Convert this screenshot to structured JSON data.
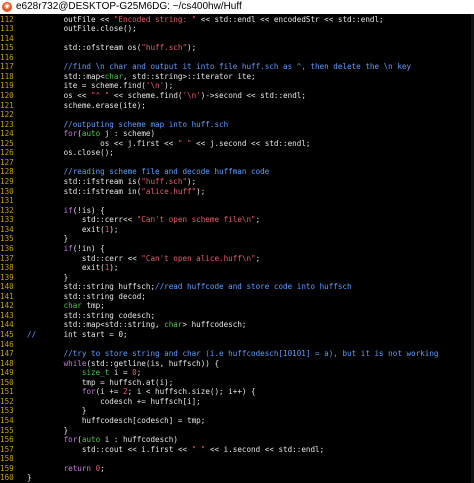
{
  "window": {
    "title": "e628r732@DESKTOP-G25M6DG: ~/cs400hw/Huff",
    "icon": "ubuntu-icon"
  },
  "colors": {
    "background": "#000000",
    "line_number": "#c4a000",
    "text": "#e5e5e5",
    "comment": "#5c9cff",
    "string": "#e35d6a",
    "number": "#e35d6a",
    "keyword": "#c678dd",
    "type": "#4ec94e"
  },
  "lines": [
    {
      "n": "112",
      "segs": [
        [
          "t",
          "        outFile << "
        ],
        [
          "s",
          "\"Encoded string: \""
        ],
        [
          "t",
          " << std::endl << encodedStr << std::endl;"
        ]
      ]
    },
    {
      "n": "113",
      "segs": [
        [
          "t",
          "        outFile.close();"
        ]
      ]
    },
    {
      "n": "114",
      "segs": []
    },
    {
      "n": "115",
      "segs": [
        [
          "t",
          "        std::ofstream os("
        ],
        [
          "s",
          "\"huff.sch\""
        ],
        [
          "t",
          ");"
        ]
      ]
    },
    {
      "n": "116",
      "segs": []
    },
    {
      "n": "117",
      "segs": [
        [
          "c",
          "        //find \\n char and output it into file huff.sch as ^, then delete the \\n key"
        ]
      ]
    },
    {
      "n": "118",
      "segs": [
        [
          "t",
          "        std::map<"
        ],
        [
          "y",
          "char"
        ],
        [
          "t",
          ", std::string>::iterator ite;"
        ]
      ]
    },
    {
      "n": "119",
      "segs": [
        [
          "t",
          "        ite = scheme.find("
        ],
        [
          "s",
          "'\\n'"
        ],
        [
          "t",
          ");"
        ]
      ]
    },
    {
      "n": "120",
      "segs": [
        [
          "t",
          "        os << "
        ],
        [
          "s",
          "\"^ \""
        ],
        [
          "t",
          " << scheme.find("
        ],
        [
          "s",
          "'\\n'"
        ],
        [
          "t",
          ")->second << std::endl;"
        ]
      ]
    },
    {
      "n": "121",
      "segs": [
        [
          "t",
          "        scheme.erase(ite);"
        ]
      ]
    },
    {
      "n": "122",
      "segs": []
    },
    {
      "n": "123",
      "segs": [
        [
          "c",
          "        //outputing scheme map into huff.sch"
        ]
      ]
    },
    {
      "n": "124",
      "segs": [
        [
          "t",
          "        "
        ],
        [
          "k",
          "for"
        ],
        [
          "t",
          "("
        ],
        [
          "y",
          "auto"
        ],
        [
          "t",
          " j : scheme)"
        ]
      ]
    },
    {
      "n": "125",
      "segs": [
        [
          "t",
          "                os << j.first << "
        ],
        [
          "s",
          "\" \""
        ],
        [
          "t",
          " << j.second << std::endl;"
        ]
      ]
    },
    {
      "n": "126",
      "segs": [
        [
          "t",
          "        os.close();"
        ]
      ]
    },
    {
      "n": "127",
      "segs": []
    },
    {
      "n": "128",
      "segs": [
        [
          "c",
          "        //reading scheme file and decode huffman code"
        ]
      ]
    },
    {
      "n": "129",
      "segs": [
        [
          "t",
          "        std::ifstream is("
        ],
        [
          "s",
          "\"huff.sch\""
        ],
        [
          "t",
          ");"
        ]
      ]
    },
    {
      "n": "130",
      "segs": [
        [
          "t",
          "        std::ifstream in("
        ],
        [
          "s",
          "\"alice.huff\""
        ],
        [
          "t",
          ");"
        ]
      ]
    },
    {
      "n": "131",
      "segs": []
    },
    {
      "n": "132",
      "segs": [
        [
          "t",
          "        "
        ],
        [
          "k",
          "if"
        ],
        [
          "t",
          "(!is) {"
        ]
      ]
    },
    {
      "n": "133",
      "segs": [
        [
          "t",
          "            std::cerr<< "
        ],
        [
          "s",
          "\"Can't open scheme file\\n\""
        ],
        [
          "t",
          ";"
        ]
      ]
    },
    {
      "n": "134",
      "segs": [
        [
          "t",
          "            exit("
        ],
        [
          "s",
          "1"
        ],
        [
          "t",
          ");"
        ]
      ]
    },
    {
      "n": "135",
      "segs": [
        [
          "t",
          "        }"
        ]
      ]
    },
    {
      "n": "136",
      "segs": [
        [
          "t",
          "        "
        ],
        [
          "k",
          "if"
        ],
        [
          "t",
          "(!in) {"
        ]
      ]
    },
    {
      "n": "137",
      "segs": [
        [
          "t",
          "            std::cerr << "
        ],
        [
          "s",
          "\"Can't open alice.huff\\n\""
        ],
        [
          "t",
          ";"
        ]
      ]
    },
    {
      "n": "138",
      "segs": [
        [
          "t",
          "            exit("
        ],
        [
          "s",
          "1"
        ],
        [
          "t",
          ");"
        ]
      ]
    },
    {
      "n": "139",
      "segs": [
        [
          "t",
          "        }"
        ]
      ]
    },
    {
      "n": "140",
      "segs": [
        [
          "t",
          "        std::string huffsch;"
        ],
        [
          "c",
          "//read huffcode and store code into huffsch"
        ]
      ]
    },
    {
      "n": "141",
      "segs": [
        [
          "t",
          "        std::string decod;"
        ]
      ]
    },
    {
      "n": "142",
      "segs": [
        [
          "t",
          "        "
        ],
        [
          "y",
          "char"
        ],
        [
          "t",
          " tmp;"
        ]
      ]
    },
    {
      "n": "143",
      "segs": [
        [
          "t",
          "        std::string codesch;"
        ]
      ]
    },
    {
      "n": "144",
      "segs": [
        [
          "t",
          "        std::map<std::string, "
        ],
        [
          "y",
          "char"
        ],
        [
          "t",
          "> huffcodesch;"
        ]
      ]
    },
    {
      "n": "145",
      "segs": [
        [
          "c",
          "//"
        ],
        [
          "t",
          "      int start = 0;"
        ]
      ]
    },
    {
      "n": "146",
      "segs": []
    },
    {
      "n": "147",
      "segs": [
        [
          "c",
          "        //try to store string and char (i.e huffcodesch[10101] = a), but it is not working"
        ]
      ]
    },
    {
      "n": "148",
      "segs": [
        [
          "t",
          "        "
        ],
        [
          "k",
          "while"
        ],
        [
          "t",
          "(std::getline(is, huffsch)) {"
        ]
      ]
    },
    {
      "n": "149",
      "segs": [
        [
          "t",
          "            "
        ],
        [
          "y",
          "size_t"
        ],
        [
          "t",
          " i = "
        ],
        [
          "s",
          "0"
        ],
        [
          "t",
          ";"
        ]
      ]
    },
    {
      "n": "150",
      "segs": [
        [
          "t",
          "            tmp = huffsch.at(i);"
        ]
      ]
    },
    {
      "n": "151",
      "segs": [
        [
          "t",
          "            "
        ],
        [
          "k",
          "for"
        ],
        [
          "t",
          "(i += "
        ],
        [
          "s",
          "2"
        ],
        [
          "t",
          "; i < huffsch.size(); i++) {"
        ]
      ]
    },
    {
      "n": "152",
      "segs": [
        [
          "t",
          "                codesch += huffsch[i];"
        ]
      ]
    },
    {
      "n": "153",
      "segs": [
        [
          "t",
          "            }"
        ]
      ]
    },
    {
      "n": "154",
      "segs": [
        [
          "t",
          "            huffcodesch[codesch] = tmp;"
        ]
      ]
    },
    {
      "n": "155",
      "segs": [
        [
          "t",
          "        }"
        ]
      ]
    },
    {
      "n": "156",
      "segs": [
        [
          "t",
          "        "
        ],
        [
          "k",
          "for"
        ],
        [
          "t",
          "("
        ],
        [
          "y",
          "auto"
        ],
        [
          "t",
          " i : huffcodesch)"
        ]
      ]
    },
    {
      "n": "157",
      "segs": [
        [
          "t",
          "            std::cout << i.first << "
        ],
        [
          "s",
          "\" \""
        ],
        [
          "t",
          " << i.second << std::endl;"
        ]
      ]
    },
    {
      "n": "158",
      "segs": []
    },
    {
      "n": "159",
      "segs": [
        [
          "t",
          "        "
        ],
        [
          "k",
          "return"
        ],
        [
          "t",
          " "
        ],
        [
          "s",
          "0"
        ],
        [
          "t",
          ";"
        ]
      ]
    },
    {
      "n": "160",
      "segs": [
        [
          "t",
          "}"
        ]
      ]
    }
  ]
}
